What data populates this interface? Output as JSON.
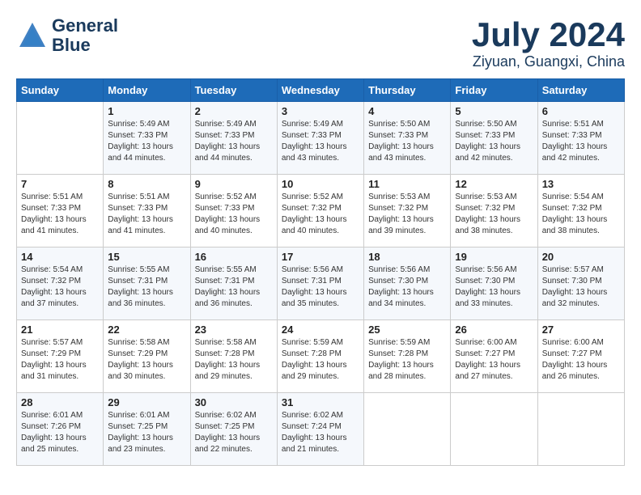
{
  "header": {
    "logo_line1": "General",
    "logo_line2": "Blue",
    "month_year": "July 2024",
    "location": "Ziyuan, Guangxi, China"
  },
  "weekdays": [
    "Sunday",
    "Monday",
    "Tuesday",
    "Wednesday",
    "Thursday",
    "Friday",
    "Saturday"
  ],
  "weeks": [
    [
      {
        "day": "",
        "sunrise": "",
        "sunset": "",
        "daylight": ""
      },
      {
        "day": "1",
        "sunrise": "5:49 AM",
        "sunset": "7:33 PM",
        "daylight": "13 hours and 44 minutes."
      },
      {
        "day": "2",
        "sunrise": "5:49 AM",
        "sunset": "7:33 PM",
        "daylight": "13 hours and 44 minutes."
      },
      {
        "day": "3",
        "sunrise": "5:49 AM",
        "sunset": "7:33 PM",
        "daylight": "13 hours and 43 minutes."
      },
      {
        "day": "4",
        "sunrise": "5:50 AM",
        "sunset": "7:33 PM",
        "daylight": "13 hours and 43 minutes."
      },
      {
        "day": "5",
        "sunrise": "5:50 AM",
        "sunset": "7:33 PM",
        "daylight": "13 hours and 42 minutes."
      },
      {
        "day": "6",
        "sunrise": "5:51 AM",
        "sunset": "7:33 PM",
        "daylight": "13 hours and 42 minutes."
      }
    ],
    [
      {
        "day": "7",
        "sunrise": "5:51 AM",
        "sunset": "7:33 PM",
        "daylight": "13 hours and 41 minutes."
      },
      {
        "day": "8",
        "sunrise": "5:51 AM",
        "sunset": "7:33 PM",
        "daylight": "13 hours and 41 minutes."
      },
      {
        "day": "9",
        "sunrise": "5:52 AM",
        "sunset": "7:33 PM",
        "daylight": "13 hours and 40 minutes."
      },
      {
        "day": "10",
        "sunrise": "5:52 AM",
        "sunset": "7:32 PM",
        "daylight": "13 hours and 40 minutes."
      },
      {
        "day": "11",
        "sunrise": "5:53 AM",
        "sunset": "7:32 PM",
        "daylight": "13 hours and 39 minutes."
      },
      {
        "day": "12",
        "sunrise": "5:53 AM",
        "sunset": "7:32 PM",
        "daylight": "13 hours and 38 minutes."
      },
      {
        "day": "13",
        "sunrise": "5:54 AM",
        "sunset": "7:32 PM",
        "daylight": "13 hours and 38 minutes."
      }
    ],
    [
      {
        "day": "14",
        "sunrise": "5:54 AM",
        "sunset": "7:32 PM",
        "daylight": "13 hours and 37 minutes."
      },
      {
        "day": "15",
        "sunrise": "5:55 AM",
        "sunset": "7:31 PM",
        "daylight": "13 hours and 36 minutes."
      },
      {
        "day": "16",
        "sunrise": "5:55 AM",
        "sunset": "7:31 PM",
        "daylight": "13 hours and 36 minutes."
      },
      {
        "day": "17",
        "sunrise": "5:56 AM",
        "sunset": "7:31 PM",
        "daylight": "13 hours and 35 minutes."
      },
      {
        "day": "18",
        "sunrise": "5:56 AM",
        "sunset": "7:30 PM",
        "daylight": "13 hours and 34 minutes."
      },
      {
        "day": "19",
        "sunrise": "5:56 AM",
        "sunset": "7:30 PM",
        "daylight": "13 hours and 33 minutes."
      },
      {
        "day": "20",
        "sunrise": "5:57 AM",
        "sunset": "7:30 PM",
        "daylight": "13 hours and 32 minutes."
      }
    ],
    [
      {
        "day": "21",
        "sunrise": "5:57 AM",
        "sunset": "7:29 PM",
        "daylight": "13 hours and 31 minutes."
      },
      {
        "day": "22",
        "sunrise": "5:58 AM",
        "sunset": "7:29 PM",
        "daylight": "13 hours and 30 minutes."
      },
      {
        "day": "23",
        "sunrise": "5:58 AM",
        "sunset": "7:28 PM",
        "daylight": "13 hours and 29 minutes."
      },
      {
        "day": "24",
        "sunrise": "5:59 AM",
        "sunset": "7:28 PM",
        "daylight": "13 hours and 29 minutes."
      },
      {
        "day": "25",
        "sunrise": "5:59 AM",
        "sunset": "7:28 PM",
        "daylight": "13 hours and 28 minutes."
      },
      {
        "day": "26",
        "sunrise": "6:00 AM",
        "sunset": "7:27 PM",
        "daylight": "13 hours and 27 minutes."
      },
      {
        "day": "27",
        "sunrise": "6:00 AM",
        "sunset": "7:27 PM",
        "daylight": "13 hours and 26 minutes."
      }
    ],
    [
      {
        "day": "28",
        "sunrise": "6:01 AM",
        "sunset": "7:26 PM",
        "daylight": "13 hours and 25 minutes."
      },
      {
        "day": "29",
        "sunrise": "6:01 AM",
        "sunset": "7:25 PM",
        "daylight": "13 hours and 23 minutes."
      },
      {
        "day": "30",
        "sunrise": "6:02 AM",
        "sunset": "7:25 PM",
        "daylight": "13 hours and 22 minutes."
      },
      {
        "day": "31",
        "sunrise": "6:02 AM",
        "sunset": "7:24 PM",
        "daylight": "13 hours and 21 minutes."
      },
      {
        "day": "",
        "sunrise": "",
        "sunset": "",
        "daylight": ""
      },
      {
        "day": "",
        "sunrise": "",
        "sunset": "",
        "daylight": ""
      },
      {
        "day": "",
        "sunrise": "",
        "sunset": "",
        "daylight": ""
      }
    ]
  ]
}
